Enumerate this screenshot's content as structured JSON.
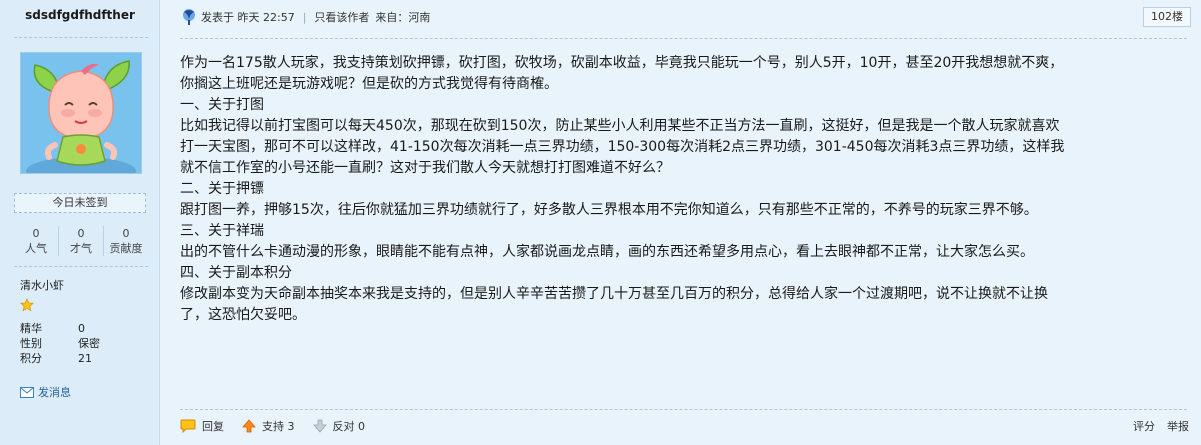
{
  "user": {
    "name": "sdsdfgdfhdfther",
    "sign_status": "今日未签到",
    "stats": [
      {
        "value": "0",
        "label": "人气"
      },
      {
        "value": "0",
        "label": "才气"
      },
      {
        "value": "0",
        "label": "贡献度"
      }
    ],
    "group": "清水小虾",
    "stars": 1,
    "info": [
      {
        "key": "精华",
        "value": "0"
      },
      {
        "key": "性别",
        "value": "保密"
      },
      {
        "key": "积分",
        "value": "21"
      }
    ],
    "message_label": "发消息"
  },
  "post": {
    "posted_label": "发表于 昨天 22:57",
    "only_author": "只看该作者",
    "origin": "来自：河南",
    "floor": "102楼",
    "lines": [
      "作为一名175散人玩家，我支持策划砍押镖，砍打图，砍牧场，砍副本收益，毕竟我只能玩一个号，别人5开，10开，甚至20开我想想就不爽，",
      "你搁这上班呢还是玩游戏呢？但是砍的方式我觉得有待商榷。",
      "一、关于打图",
      "比如我记得以前打宝图可以每天450次，那现在砍到150次，防止某些小人利用某些不正当方法一直刷，这挺好，但是我是一个散人玩家就喜欢",
      "打一天宝图，那可不可以这样改，41-150次每次消耗一点三界功绩，150-300每次消耗2点三界功绩，301-450每次消耗3点三界功绩，这样我",
      "就不信工作室的小号还能一直刷？这对于我们散人今天就想打打图难道不好么？",
      "二、关于押镖",
      "跟打图一养，押够15次，往后你就猛加三界功绩就行了，好多散人三界根本用不完你知道么，只有那些不正常的，不养号的玩家三界不够。",
      "三、关于祥瑞",
      "出的不管什么卡通动漫的形象，眼睛能不能有点神，人家都说画龙点睛，画的东西还希望多用点心，看上去眼神都不正常，让大家怎么买。",
      "四、关于副本积分",
      "修改副本变为天命副本抽奖本来我是支持的，但是别人辛辛苦苦攒了几十万甚至几百万的积分，总得给人家一个过渡期吧，说不让换就不让换",
      "了，这恐怕欠妥吧。"
    ]
  },
  "footer": {
    "reply": "回复",
    "support": "支持 3",
    "oppose": "反对 0",
    "rate": "评分",
    "report": "举报"
  }
}
